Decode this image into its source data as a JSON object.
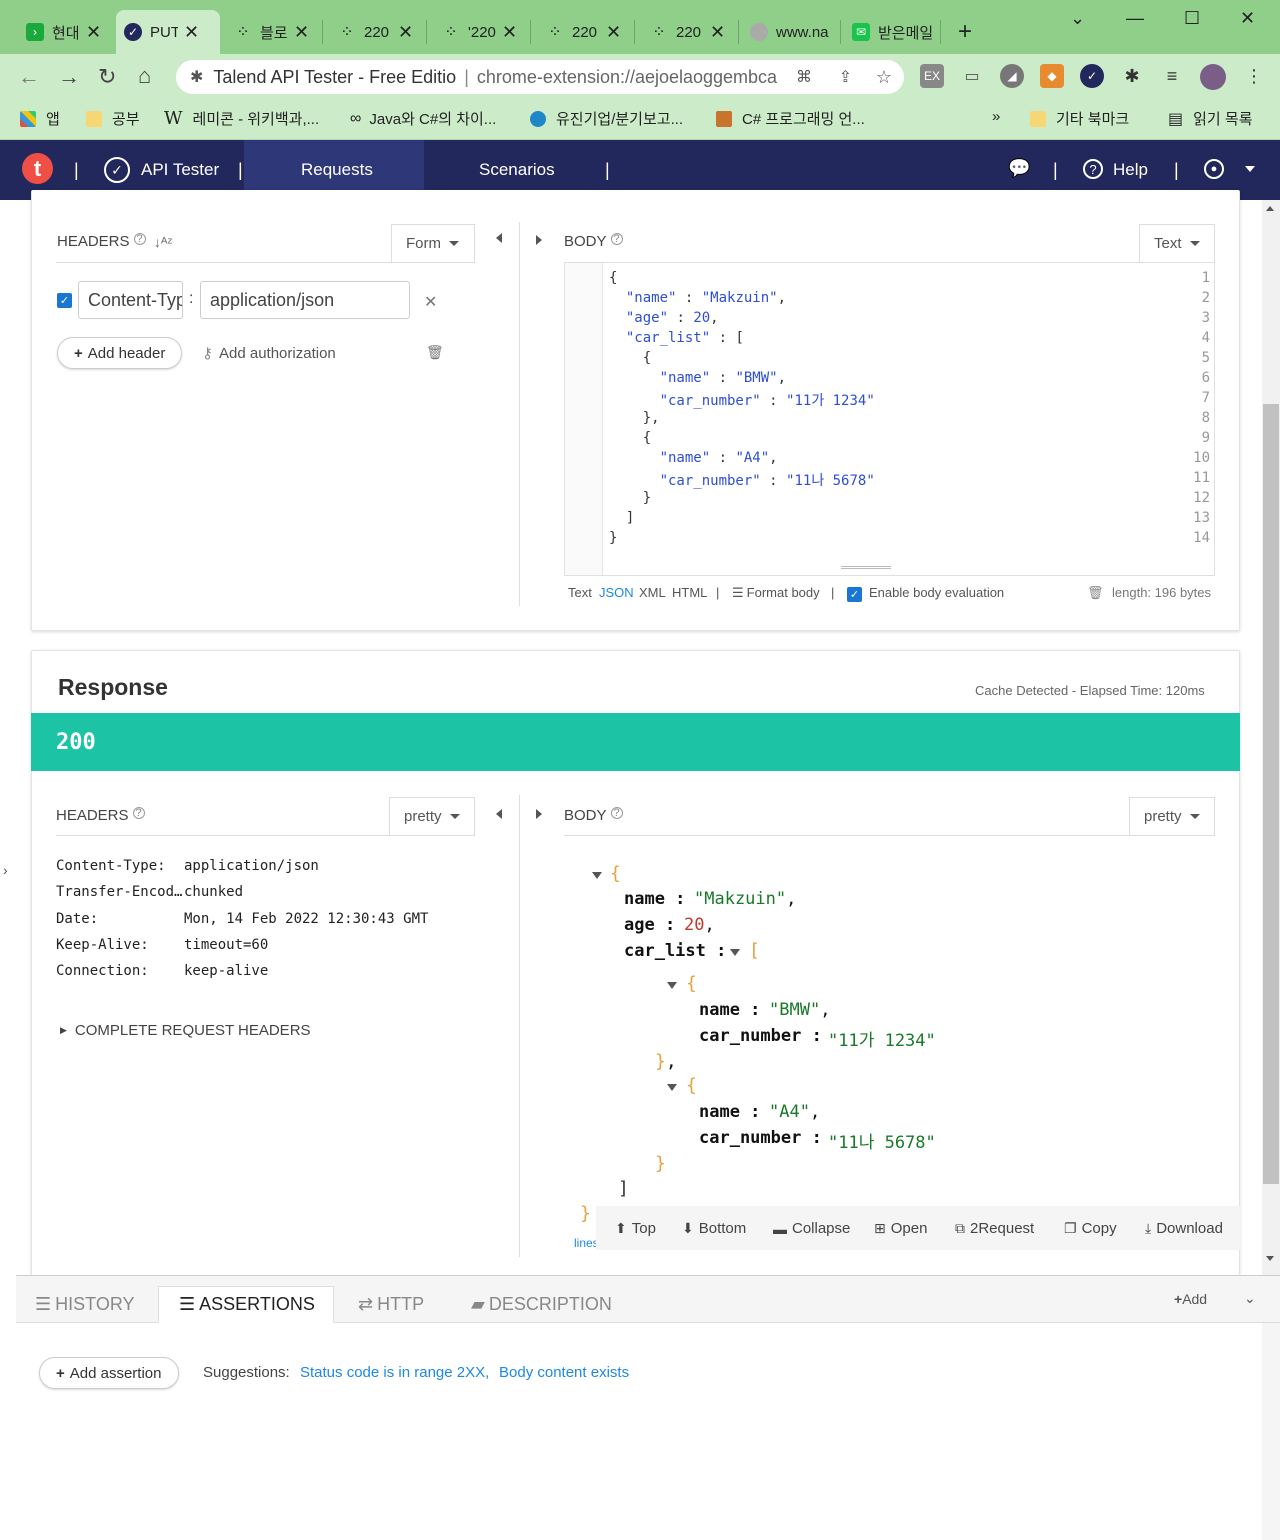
{
  "browser": {
    "tabs": [
      {
        "title": "현대",
        "favicon_color": "#1ba93d",
        "icon": "naver-series-icon"
      },
      {
        "title": "PUT",
        "favicon_color": "#22275c",
        "icon": "check-circle-icon"
      },
      {
        "title": "블로",
        "favicon_color": "#333333",
        "icon": "dots-icon"
      },
      {
        "title": "220",
        "favicon_color": "#333333",
        "icon": "dots-icon"
      },
      {
        "title": "'220",
        "favicon_color": "#333333",
        "icon": "dots-icon"
      },
      {
        "title": "220",
        "favicon_color": "#333333",
        "icon": "dots-icon"
      },
      {
        "title": "220",
        "favicon_color": "#333333",
        "icon": "dots-icon"
      },
      {
        "title": "www.na",
        "favicon_color": "#888888",
        "icon": "globe-icon"
      },
      {
        "title": "받은메일",
        "favicon_color": "#19c34c",
        "icon": "mail-icon"
      }
    ],
    "omnibox": {
      "site_name": "Talend API Tester - Free Editio",
      "url": "chrome-extension://aejoelaoggembcahagimdiliamlcdmfm"
    },
    "bookmarks": [
      {
        "label": "앱",
        "icon": "apps-grid-icon"
      },
      {
        "label": "공부",
        "icon": "folder-icon"
      },
      {
        "label": "레미콘 - 위키백과,...",
        "icon": "wikipedia-icon"
      },
      {
        "label": "Java와 C#의 차이...",
        "icon": "link-icon"
      },
      {
        "label": "유진기업/분기보고...",
        "icon": "globe-icon"
      },
      {
        "label": "C# 프로그래밍 언...",
        "icon": "image-icon"
      },
      {
        "label": "»",
        "icon": ""
      },
      {
        "label": "기타 북마크",
        "icon": "folder-icon"
      },
      {
        "label": "읽기 목록",
        "icon": "reading-list-icon"
      }
    ]
  },
  "app": {
    "brand": "API Tester",
    "nav": [
      "Requests",
      "Scenarios"
    ],
    "help": "Help",
    "accent": "#22275c"
  },
  "request": {
    "headers_label": "HEADERS",
    "headers_mode": "Form",
    "header_row": {
      "name": "Content-Type",
      "value": "application/json"
    },
    "add_header": "Add header",
    "add_authorization": "Add authorization",
    "body_label": "BODY",
    "body_mode": "Text",
    "body_lines": [
      "{",
      "  \"name\" : \"Makzuin\",",
      "  \"age\" : 20,",
      "  \"car_list\" : [",
      "    {",
      "      \"name\" : \"BMW\",",
      "      \"car_number\" : \"11가 1234\"",
      "    },",
      "    {",
      "      \"name\" : \"A4\",",
      "      \"car_number\" : \"11나 5678\"",
      "    }",
      "  ]",
      "}"
    ],
    "line_numbers": [
      "1",
      "2",
      "3",
      "4",
      "5",
      "6",
      "7",
      "8",
      "9",
      "10",
      "11",
      "12",
      "13",
      "14"
    ],
    "formats": [
      "Text",
      "JSON",
      "XML",
      "HTML"
    ],
    "selected_format": "JSON",
    "format_body": "Format body",
    "enable_eval": "Enable body evaluation",
    "length": "length: 196 bytes"
  },
  "response": {
    "title": "Response",
    "meta": "Cache Detected - Elapsed Time: 120ms",
    "status": "200",
    "status_color": "#1cc3a5",
    "headers_label": "HEADERS",
    "headers_mode": "pretty",
    "headers": [
      {
        "key": "Content-Type:",
        "value": "application/json"
      },
      {
        "key": "Transfer-Encod…",
        "value": "chunked"
      },
      {
        "key": "Date:",
        "value": "Mon, 14 Feb 2022 12:30:43 GMT"
      },
      {
        "key": "Keep-Alive:",
        "value": "timeout=60"
      },
      {
        "key": "Connection:",
        "value": "keep-alive"
      }
    ],
    "complete_headers": "COMPLETE REQUEST HEADERS",
    "body_label": "BODY",
    "body_mode": "pretty",
    "json": {
      "name_key": "name :",
      "name_val": "\"Makzuin\"",
      "age_key": "age :",
      "age_val": "20",
      "list_key": "car_list :",
      "car1_name": "\"BMW\"",
      "car1_number": "\"11가 1234\"",
      "car2_name": "\"A4\"",
      "car2_number": "\"11나 5678\"",
      "car_name_key": "name :",
      "car_number_key": "car_number :"
    },
    "tools": [
      "Top",
      "Bottom",
      "Collapse",
      "Open",
      "2Request",
      "Copy",
      "Download"
    ],
    "lines_link": "lines"
  },
  "bottom": {
    "tabs": [
      "HISTORY",
      "ASSERTIONS",
      "HTTP",
      "DESCRIPTION"
    ],
    "active_tab": "ASSERTIONS",
    "add": "Add",
    "add_assertion": "Add assertion",
    "suggestions_label": "Suggestions:",
    "suggestions": [
      "Status code is in range 2XX,",
      "Body content exists"
    ]
  }
}
